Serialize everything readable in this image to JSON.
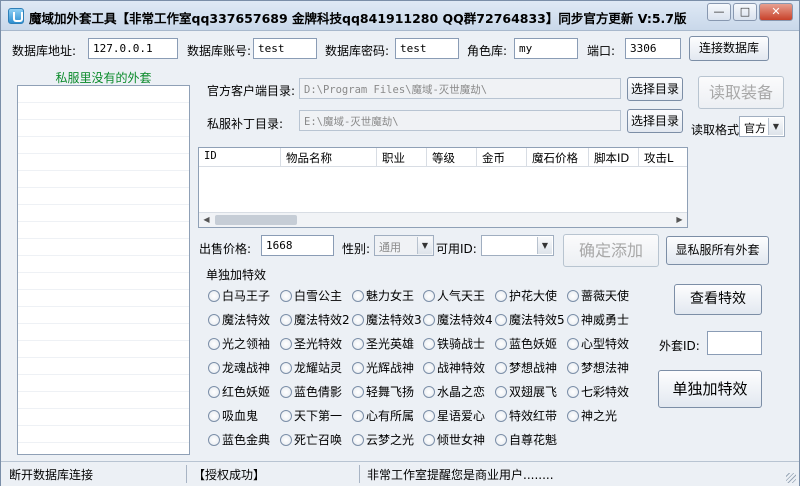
{
  "window": {
    "title": "魔域加外套工具【非常工作室qq337657689 金牌科技qq841911280 QQ群72764833】同步官方更新 V:5.7版",
    "minimize": "—",
    "maximize": "□",
    "close": "✕"
  },
  "db": {
    "address_label": "数据库地址:",
    "address_value": "127.0.0.1",
    "account_label": "数据库账号:",
    "account_value": "test",
    "password_label": "数据库密码:",
    "password_value": "test",
    "role_label": "角色库:",
    "role_value": "my",
    "port_label": "端口:",
    "port_value": "3306",
    "connect_button": "连接数据库"
  },
  "left_panel": {
    "title": "私服里没有的外套"
  },
  "paths": {
    "official_label": "官方客户端目录:",
    "official_value": "D:\\Program Files\\魔域-灭世魔劫\\",
    "private_label": "私服补丁目录:",
    "private_value": "E:\\魔域-灭世魔劫\\",
    "select_button_1": "选择目录",
    "select_button_2": "选择目录",
    "read_button": "读取装备",
    "format_label": "读取格式",
    "format_value": "官方"
  },
  "table": {
    "columns": [
      "ID",
      "物品名称",
      "职业",
      "等级",
      "金币",
      "魔石价格",
      "脚本ID",
      "攻击L"
    ]
  },
  "sale": {
    "price_label": "出售价格:",
    "price_value": "1668",
    "gender_label": "性别:",
    "gender_value": "通用",
    "usable_label": "可用ID:",
    "usable_value": "",
    "confirm_button": "确定添加",
    "show_all_button": "显私服所有外套"
  },
  "effects": {
    "group_title": "单独加特效",
    "items": [
      "白马王子",
      "白雪公主",
      "魅力女王",
      "人气天王",
      "护花大使",
      "蔷薇天使",
      "魔法特效",
      "魔法特效2",
      "魔法特效3",
      "魔法特效4",
      "魔法特效5",
      "神威勇士",
      "光之领袖",
      "圣光特效",
      "圣光英雄",
      "铁骑战士",
      "蓝色妖姬",
      "心型特效",
      "龙魂战神",
      "龙耀站灵",
      "光辉战神",
      "战神特效",
      "梦想战神",
      "梦想法神",
      "红色妖姬",
      "蓝色倩影",
      "轻舞飞扬",
      "水晶之恋",
      "双翅展飞",
      "七彩特效",
      "吸血鬼",
      "天下第一",
      "心有所属",
      "星语爱心",
      "特效红带",
      "神之光",
      "蓝色金典",
      "死亡召唤",
      "云梦之光",
      "倾世女神",
      "自尊花魁"
    ],
    "view_button": "查看特效",
    "coat_id_label": "外套ID:",
    "coat_id_value": "",
    "add_effect_button": "单独加特效"
  },
  "status": {
    "left": "断开数据库连接",
    "middle": "【授权成功】",
    "right": "非常工作室提醒您是商业用户........"
  },
  "colors": {
    "accent_green": "#0a8a2a",
    "window_bg": "#ecf0f5"
  }
}
